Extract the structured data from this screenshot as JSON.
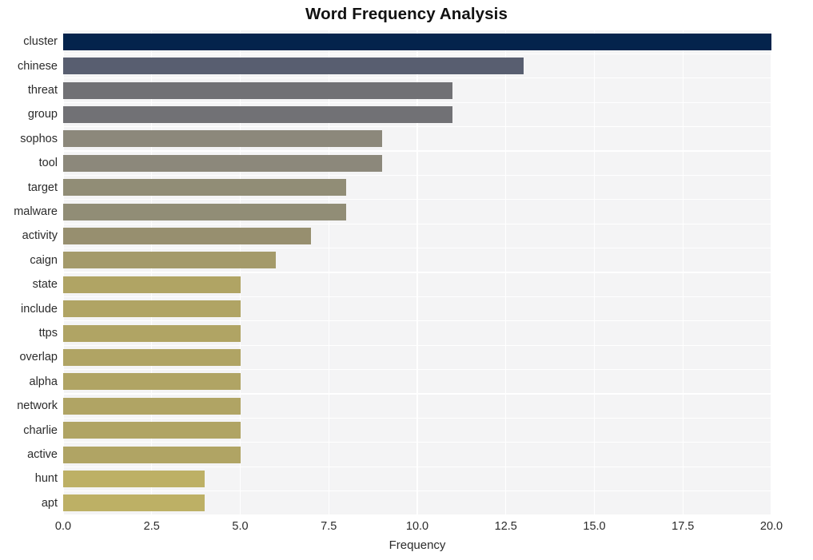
{
  "chart_data": {
    "type": "bar",
    "orientation": "horizontal",
    "title": "Word Frequency Analysis",
    "xlabel": "Frequency",
    "ylabel": "",
    "xlim": [
      0,
      20
    ],
    "ylim": null,
    "grid": true,
    "legend": null,
    "xticks": [
      "0.0",
      "2.5",
      "5.0",
      "7.5",
      "10.0",
      "12.5",
      "15.0",
      "17.5",
      "20.0"
    ],
    "xtick_values": [
      0,
      2.5,
      5,
      7.5,
      10,
      12.5,
      15,
      17.5,
      20
    ],
    "categories": [
      "cluster",
      "chinese",
      "threat",
      "group",
      "sophos",
      "tool",
      "target",
      "malware",
      "activity",
      "caign",
      "state",
      "include",
      "ttps",
      "overlap",
      "alpha",
      "network",
      "charlie",
      "active",
      "hunt",
      "apt"
    ],
    "values": [
      20,
      13,
      11,
      11,
      9,
      9,
      8,
      8,
      7,
      6,
      5,
      5,
      5,
      5,
      5,
      5,
      5,
      5,
      4,
      4
    ],
    "bar_colors": [
      "#04234c",
      "#585e70",
      "#717175",
      "#717175",
      "#8c887b",
      "#8c887b",
      "#918d76",
      "#918d76",
      "#978f6f",
      "#a49a6a",
      "#b0a464",
      "#b0a464",
      "#b0a464",
      "#b0a464",
      "#b0a464",
      "#b0a464",
      "#b0a464",
      "#b0a464",
      "#bdb065",
      "#bdb065"
    ],
    "plot_background": "#f4f4f5",
    "gridline_color": "#ffffff",
    "figure_background": "#ffffff"
  }
}
